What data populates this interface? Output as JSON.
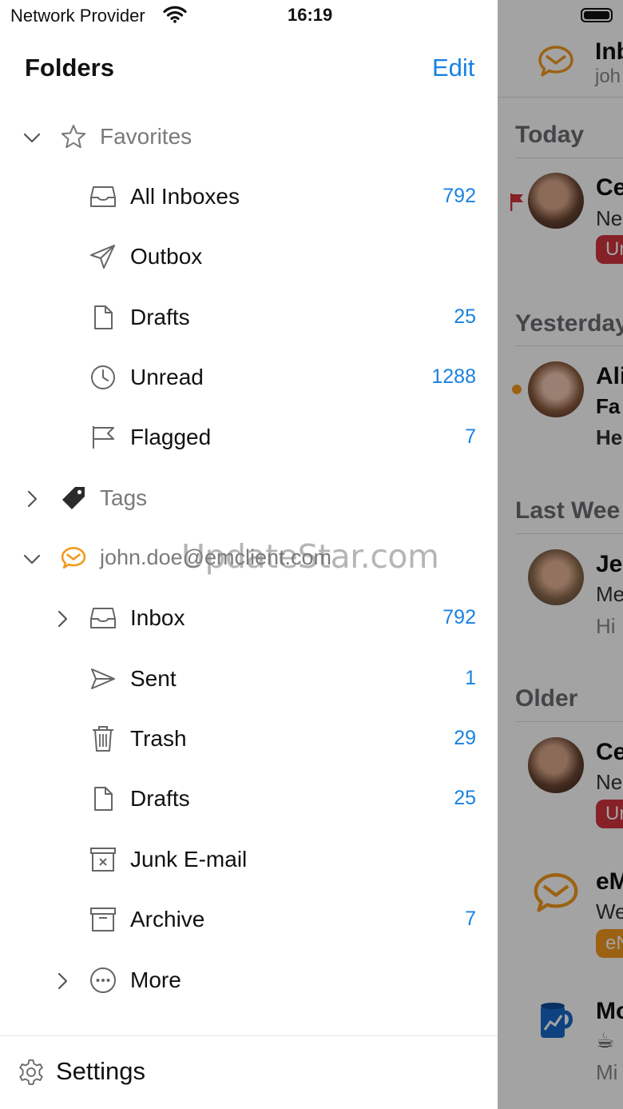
{
  "status_bar": {
    "provider": "Network Provider",
    "time": "16:19",
    "wifi_icon": "wifi-icon"
  },
  "header": {
    "title": "Folders",
    "edit_label": "Edit"
  },
  "favorites": {
    "label": "Favorites",
    "items": [
      {
        "label": "All Inboxes",
        "count": "792",
        "icon": "inbox-tray-icon"
      },
      {
        "label": "Outbox",
        "count": "",
        "icon": "paper-plane-icon"
      },
      {
        "label": "Drafts",
        "count": "25",
        "icon": "document-icon"
      },
      {
        "label": "Unread",
        "count": "1288",
        "icon": "clock-icon"
      },
      {
        "label": "Flagged",
        "count": "7",
        "icon": "flag-icon"
      }
    ]
  },
  "tags": {
    "label": "Tags"
  },
  "account": {
    "label": "john.doe@emclient.com",
    "items": [
      {
        "label": "Inbox",
        "count": "792",
        "icon": "inbox-tray-icon"
      },
      {
        "label": "Sent",
        "count": "1",
        "icon": "send-icon"
      },
      {
        "label": "Trash",
        "count": "29",
        "icon": "trash-icon"
      },
      {
        "label": "Drafts",
        "count": "25",
        "icon": "document-icon"
      },
      {
        "label": "Junk E-mail",
        "count": "",
        "icon": "junk-box-icon"
      },
      {
        "label": "Archive",
        "count": "7",
        "icon": "archive-box-icon"
      },
      {
        "label": "More",
        "count": "",
        "icon": "more-circle-icon"
      }
    ]
  },
  "settings": {
    "label": "Settings"
  },
  "watermark": "UpdateStar.com",
  "background_list": {
    "title": "Inb",
    "subtitle": "joh",
    "sections": [
      "Today",
      "Yesterday",
      "Last Wee",
      "Older"
    ],
    "messages": [
      {
        "line1": "Ce",
        "line2": "Ne",
        "tag": "Ur"
      },
      {
        "line1": "Ali",
        "line2": "Fa",
        "line3": "He"
      },
      {
        "line1": "Je",
        "line2": "Me",
        "line3": "Hi"
      },
      {
        "line1": "Ce",
        "line2": "Ne",
        "tag": "Ur"
      },
      {
        "line1": "eM",
        "line2": "We",
        "tag": "eN"
      },
      {
        "line1": "Mo",
        "line2": "☕",
        "line3": "Mi"
      }
    ]
  },
  "colors": {
    "accent": "#1a82e2",
    "brand_orange": "#f29a1e",
    "tag_red": "#d0343e",
    "tag_orange": "#f29a1e",
    "dim_overlay": "rgba(0,0,0,0.36)"
  }
}
